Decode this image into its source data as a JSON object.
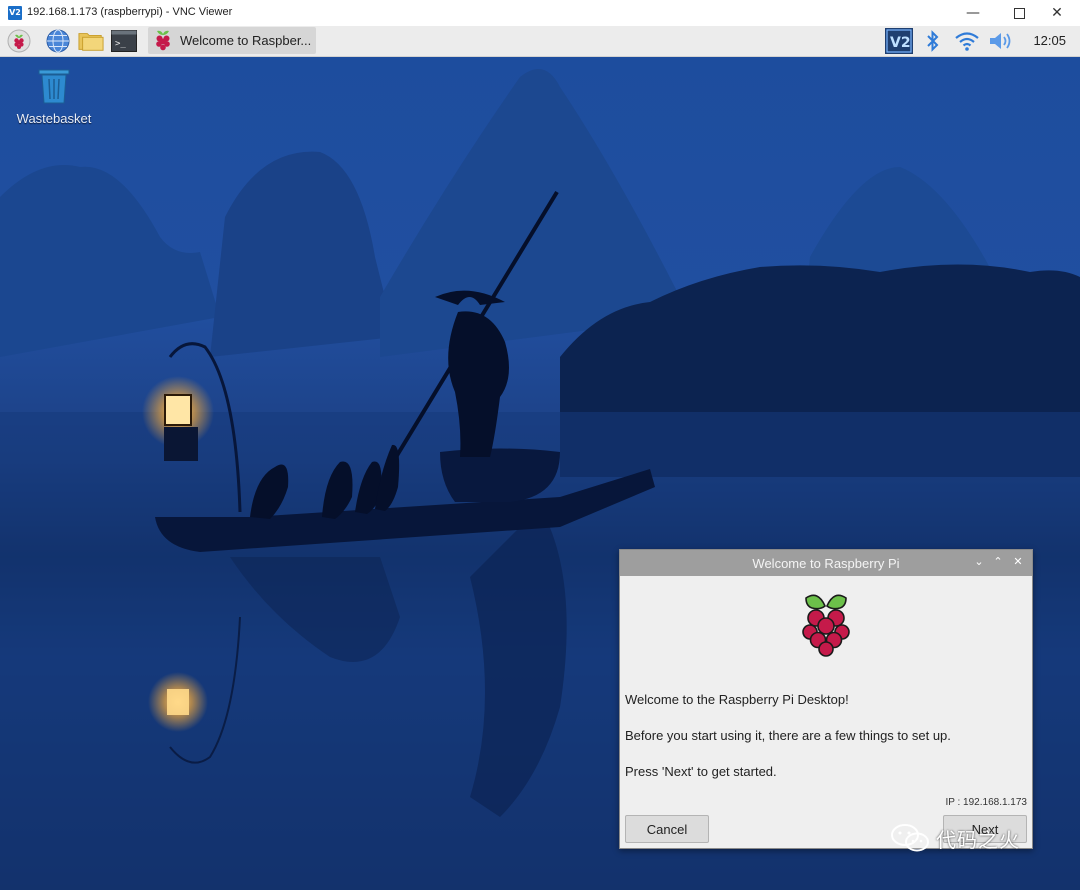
{
  "window": {
    "title": "192.168.1.173 (raspberrypi) - VNC Viewer",
    "logo_text": "V2",
    "controls": [
      "minimize-icon",
      "maximize-icon",
      "close-icon"
    ]
  },
  "taskbar": {
    "launchers": [
      "raspberry-menu-icon",
      "web-browser-icon",
      "file-manager-icon",
      "terminal-icon"
    ],
    "active_task_label": "Welcome to Raspber...",
    "tray": [
      "vnc-server-icon",
      "bluetooth-icon",
      "wifi-icon",
      "volume-icon"
    ],
    "clock": "12:05"
  },
  "desktop": {
    "icons": [
      {
        "label": "Wastebasket",
        "icon": "trash-icon"
      }
    ]
  },
  "dialog": {
    "title": "Welcome to Raspberry Pi",
    "line1": "Welcome to the Raspberry Pi Desktop!",
    "line2": "Before you start using it, there are a few things to set up.",
    "line3": "Press 'Next' to get started.",
    "ip": "IP : 192.168.1.173",
    "cancel_label": "Cancel",
    "next_label": "Next"
  },
  "watermark": {
    "text": "代码之火"
  },
  "colors": {
    "accent_vnc": "#1a6ec8",
    "taskbar_bg": "#ececec",
    "dialog_title_bg": "#9e9e9e",
    "raspberry_red": "#c51a4a",
    "leaf_green": "#6cc04a"
  }
}
